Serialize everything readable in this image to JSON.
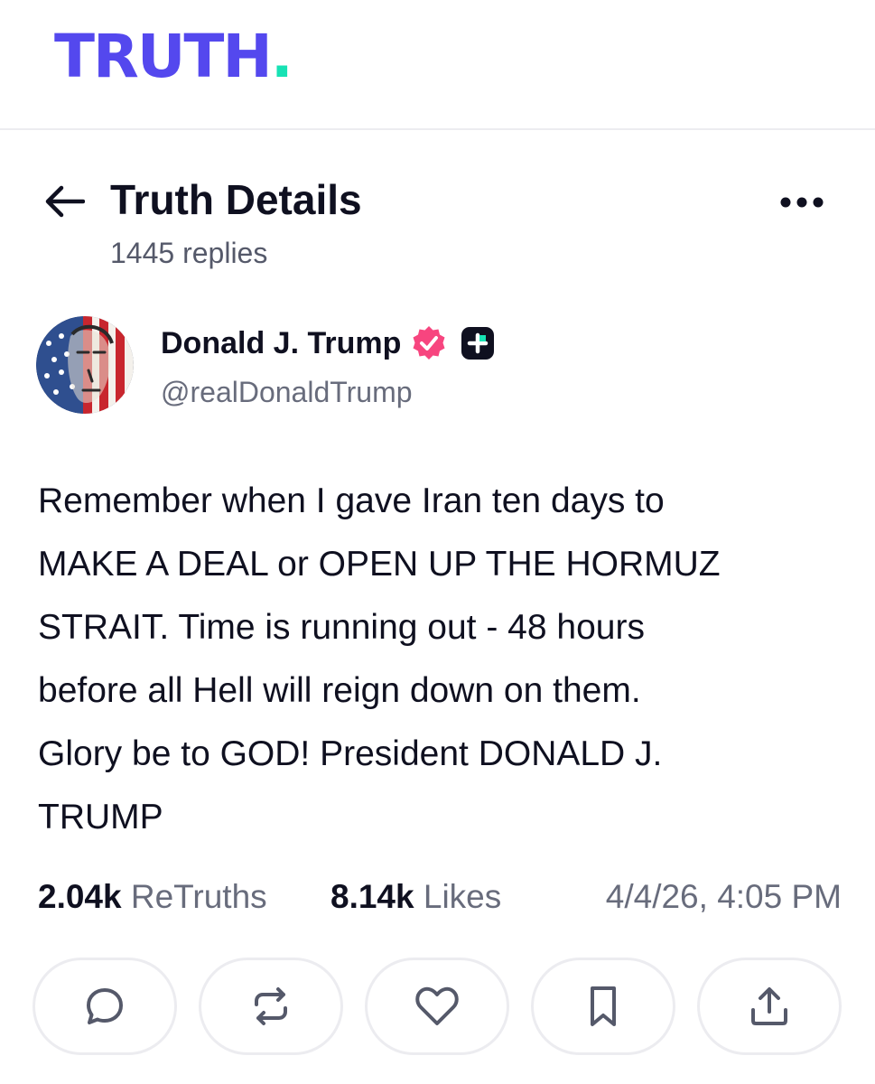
{
  "brand": {
    "logo_text": "TRUTH",
    "logo_dot": ".",
    "logo_color": "#5448ee",
    "dot_color": "#17e2b4"
  },
  "header": {
    "title": "Truth Details",
    "subtitle": "1445 replies",
    "back_icon": "arrow-left-icon",
    "more_icon": "more-horizontal-icon"
  },
  "author": {
    "display_name": "Donald J. Trump",
    "handle": "@realDonaldTrump",
    "verified_color": "#f7457f",
    "avatar_icon": "flag-portrait-avatar"
  },
  "post": {
    "text": "Remember when I gave Iran ten days to\nMAKE A DEAL or OPEN UP THE HORMUZ\nSTRAIT. Time is running out - 48 hours\nbefore all Hell will reign down on them.\nGlory be to GOD! President DONALD J.\nTRUMP"
  },
  "stats": {
    "retruths_count": "2.04k",
    "retruths_label": "ReTruths",
    "likes_count": "8.14k",
    "likes_label": "Likes",
    "timestamp": "4/4/26, 4:05 PM"
  },
  "actions": [
    {
      "icon": "reply-icon"
    },
    {
      "icon": "retruth-icon"
    },
    {
      "icon": "like-icon"
    },
    {
      "icon": "bookmark-icon"
    },
    {
      "icon": "share-icon"
    }
  ]
}
